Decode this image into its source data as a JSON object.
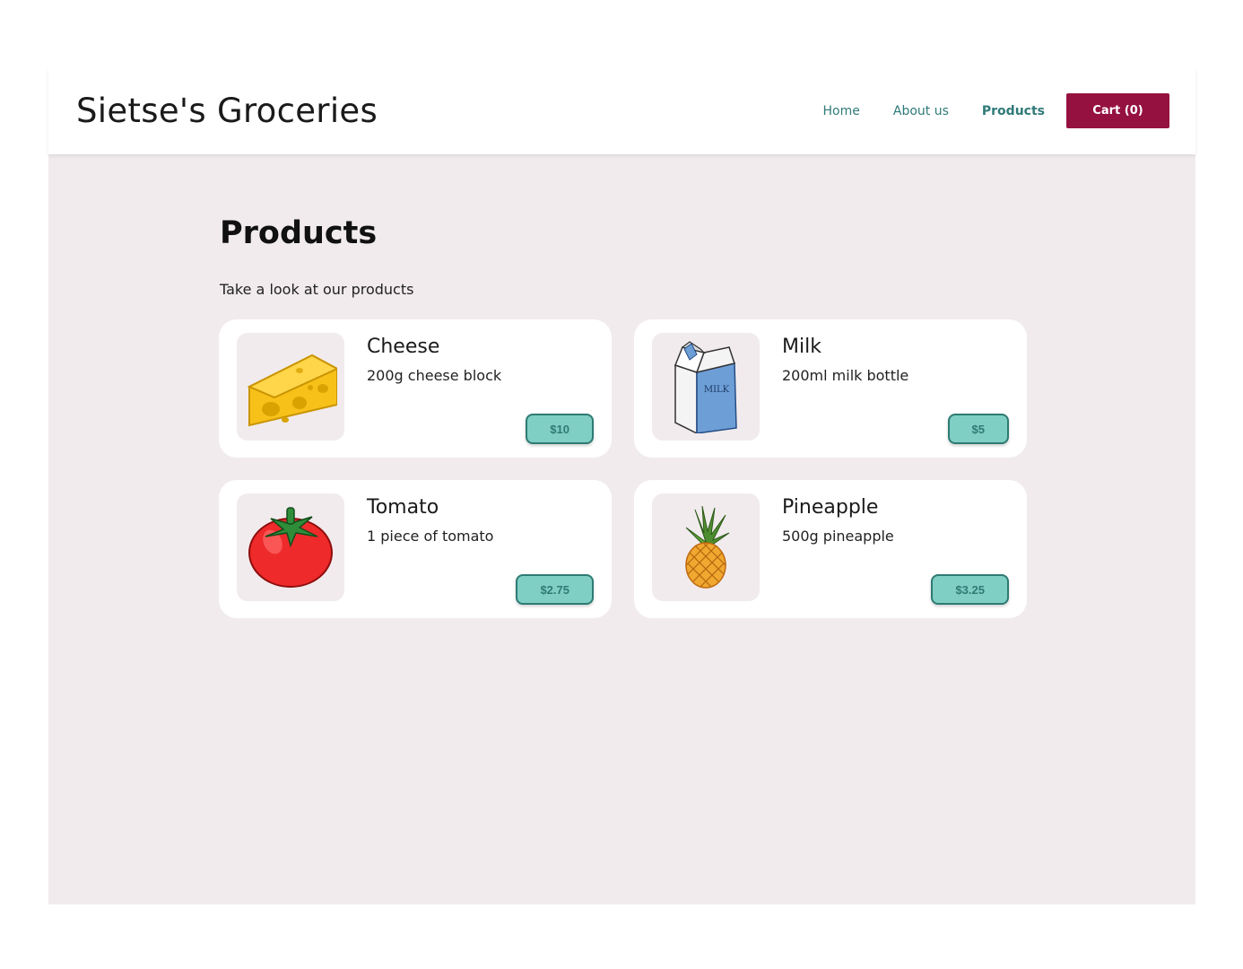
{
  "header": {
    "site_title": "Sietse's Groceries",
    "nav": {
      "home": "Home",
      "about": "About us",
      "products": "Products",
      "cart": "Cart (0)"
    }
  },
  "main": {
    "heading": "Products",
    "subtitle": "Take a look at our products",
    "products": [
      {
        "name": "Cheese",
        "description": "200g cheese block",
        "price": "$10",
        "icon": "cheese-icon"
      },
      {
        "name": "Milk",
        "description": "200ml milk bottle",
        "price": "$5",
        "icon": "milk-carton-icon",
        "icon_text": "MILK"
      },
      {
        "name": "Tomato",
        "description": "1 piece of tomato",
        "price": "$2.75",
        "icon": "tomato-icon"
      },
      {
        "name": "Pineapple",
        "description": "500g pineapple",
        "price": "$3.25",
        "icon": "pineapple-icon"
      }
    ]
  },
  "colors": {
    "accent": "#951140",
    "link": "#2f7a78",
    "price_bg": "#80cfc5",
    "page_bg": "#f1ebed"
  }
}
